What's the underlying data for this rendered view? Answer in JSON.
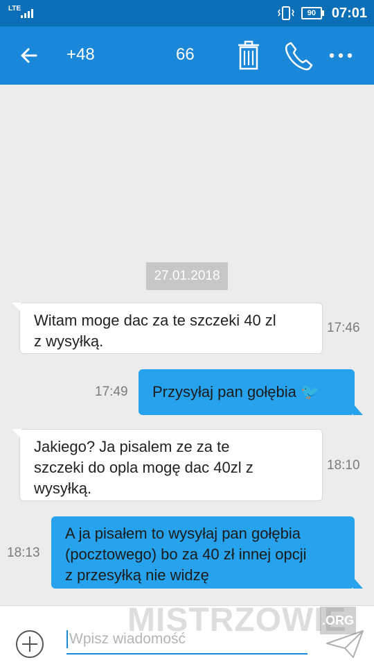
{
  "status_bar": {
    "network": "LTE",
    "battery": "90",
    "time": "07:01"
  },
  "toolbar": {
    "contact_start": "+48",
    "contact_end": "66"
  },
  "conversation": {
    "date": "27.01.2018",
    "messages": [
      {
        "direction": "incoming",
        "lines": [
          "Witam moge dac za te szczeki 40 zl",
          "z wysyłką."
        ],
        "time": "17:46"
      },
      {
        "direction": "outgoing",
        "lines": [
          "Przysyłaj pan gołębia 🐦"
        ],
        "time": "17:49"
      },
      {
        "direction": "incoming",
        "lines": [
          "Jakiego? Ja pisalem ze za te",
          "szczeki do opla mogę dac 40zl z",
          "wysyłką."
        ],
        "time": "18:10"
      },
      {
        "direction": "outgoing",
        "lines": [
          "A ja pisałem to wysyłaj pan gołębia",
          "(pocztowego) bo za 40 zł innej opcji",
          "z przesyłką nie widzę"
        ],
        "time": "18:13"
      }
    ]
  },
  "composer": {
    "placeholder": "Wpisz wiadomość"
  },
  "watermark": {
    "text": "MISTRZOWIE",
    "org": ".ORG"
  },
  "colors": {
    "status_bar": "#0b6fb8",
    "toolbar": "#1a87d8",
    "outgoing_bubble": "#27a3ee",
    "incoming_bubble": "#ffffff",
    "background": "#ececec"
  },
  "icons": [
    "back-arrow-icon",
    "trash-icon",
    "phone-icon",
    "more-icon",
    "plus-icon",
    "send-icon",
    "vibrate-icon",
    "signal-icon"
  ]
}
